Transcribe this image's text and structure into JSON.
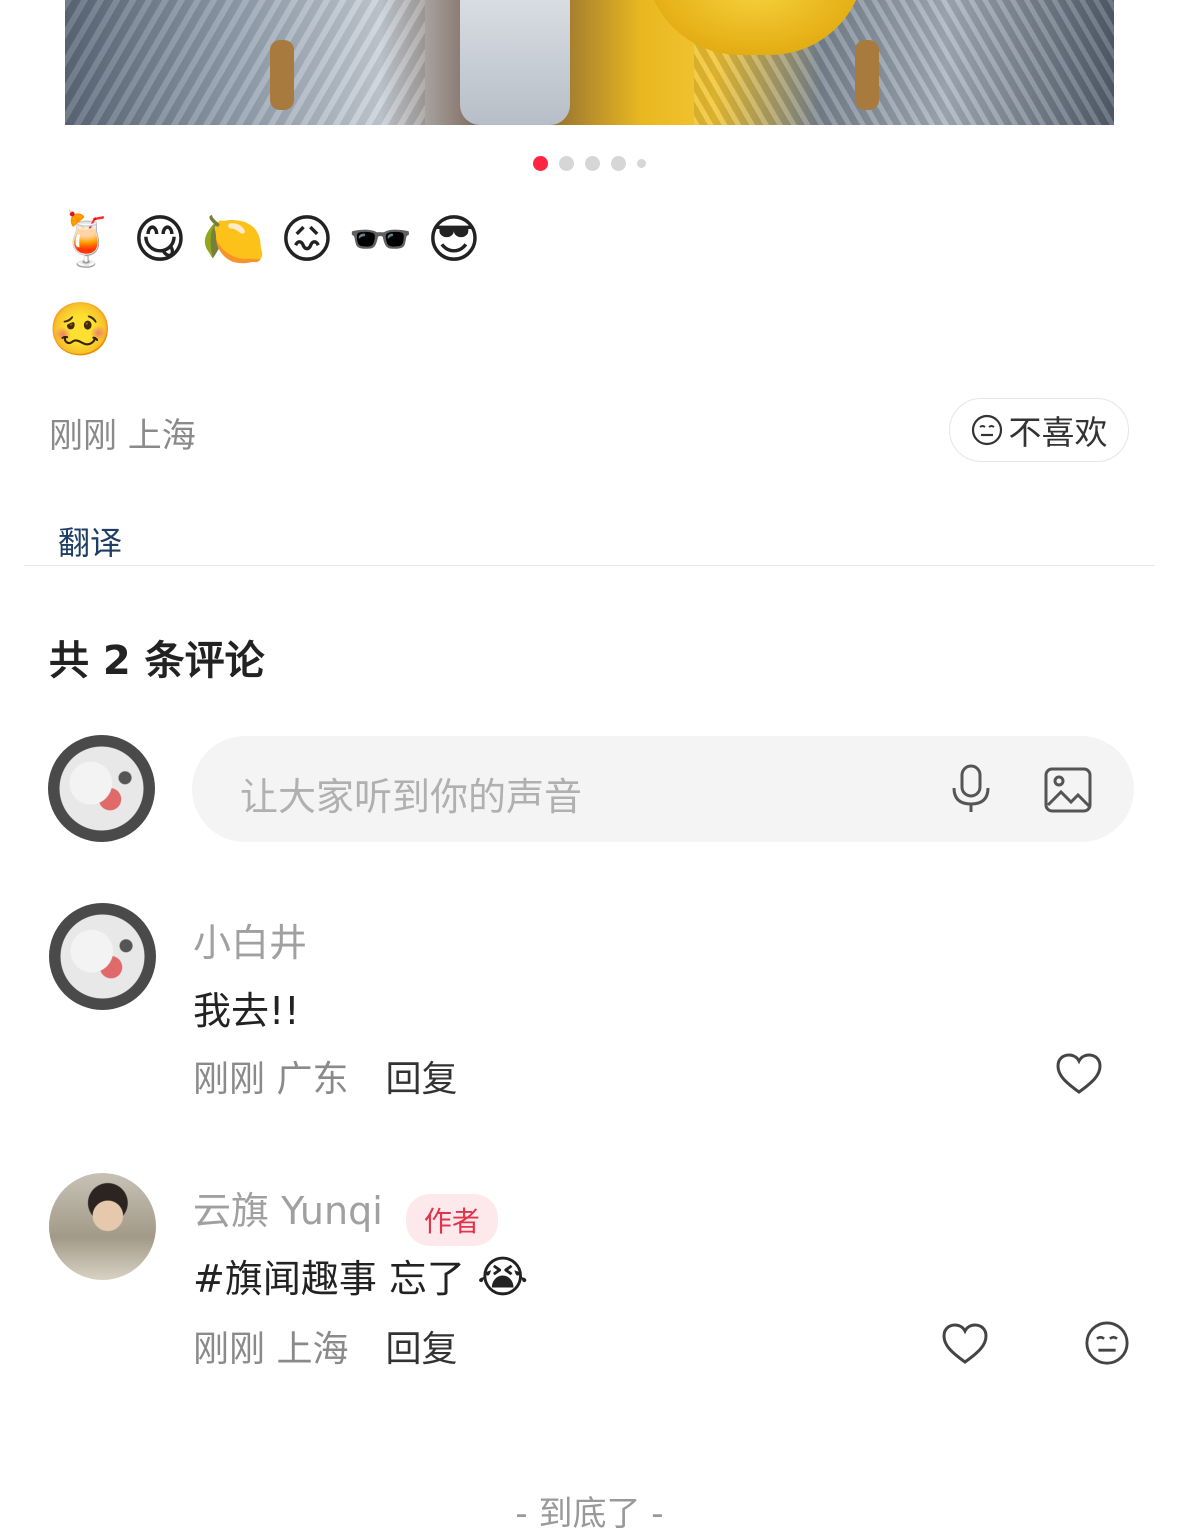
{
  "post": {
    "image_alt": "post image carousel",
    "carousel": {
      "total": 5,
      "active_index": 0
    },
    "content_emojis": [
      "🍹",
      "😋",
      "🍋",
      "😖",
      "🕶️",
      "😎"
    ],
    "sticker": "🥴",
    "meta": "刚刚 上海",
    "dislike_label": "不喜欢",
    "translate_label": "翻译"
  },
  "comments_section": {
    "count_label": "共 2 条评论",
    "input_placeholder": "让大家听到你的声音",
    "comments": [
      {
        "author": "小白井",
        "text": "我去!!",
        "meta": "刚刚 广东",
        "reply_label": "回复"
      },
      {
        "author": "云旗 Yunqi",
        "badge": "作者",
        "text": "#旗闻趣事 忘了",
        "text_emoji": "😭",
        "meta": "刚刚 上海",
        "reply_label": "回复"
      }
    ],
    "end_label": "- 到底了 -"
  },
  "colors": {
    "accent": "#ff2442",
    "badge_text": "#e3334a",
    "link": "#1f3e66"
  },
  "icons": [
    "face-neutral-icon",
    "microphone-icon",
    "image-icon",
    "heart-icon"
  ]
}
